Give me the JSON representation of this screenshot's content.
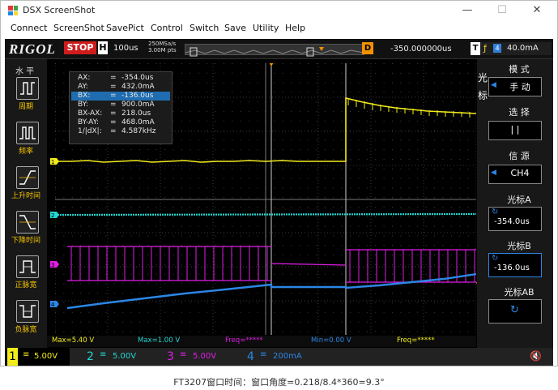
{
  "window": {
    "title": "DSX ScreenShot",
    "minimize": "—",
    "maximize": "☐",
    "close": "✕"
  },
  "menu": [
    "Connect",
    "ScreenShot",
    "SavePict",
    "Control",
    "Switch",
    "Save",
    "Utility",
    "Help"
  ],
  "scope": {
    "logo": "RIGOL",
    "run_state": "STOP",
    "timebase_label": "H",
    "timebase_value": "100us",
    "sample_rate": "250MSa/s",
    "mem_depth": "3.00M pts",
    "delay_label": "D",
    "delay_value": "-350.000000us",
    "trigger_label": "T",
    "trigger_source": "4",
    "trigger_level": "40.0mA",
    "colors": {
      "ch1": "#f3ec1c",
      "ch2": "#21d7d0",
      "ch3": "#e11ee6",
      "ch4": "#2c86e6",
      "accent": "#f29100"
    }
  },
  "left_panel": {
    "title": "水 平",
    "items": [
      {
        "icon": "period-icon",
        "label": "周期"
      },
      {
        "icon": "frequency-icon",
        "label": "频率"
      },
      {
        "icon": "rise-time-icon",
        "label": "上升时间"
      },
      {
        "icon": "fall-time-icon",
        "label": "下降时间"
      },
      {
        "icon": "positive-width-icon",
        "label": "正脉宽"
      },
      {
        "icon": "negative-width-icon",
        "label": "负脉宽"
      }
    ]
  },
  "cursor_readout": [
    {
      "k": "AX:",
      "v": "-354.0us"
    },
    {
      "k": "AY:",
      "v": "432.0mA"
    },
    {
      "k": "BX:",
      "v": "-136.0us"
    },
    {
      "k": "BY:",
      "v": "900.0mA"
    },
    {
      "k": "BX-AX:",
      "v": "218.0us"
    },
    {
      "k": "BY-AY:",
      "v": "468.0mA"
    },
    {
      "k": "1/|dX|:",
      "v": "4.587kHz"
    }
  ],
  "right_panel": {
    "cursor_tag": "光标",
    "mode_title": "模 式",
    "mode_value": "手 动",
    "select_title": "选 择",
    "select_value": "| |",
    "source_title": "信 源",
    "source_value": "CH4",
    "cursor_a_title": "光标A",
    "cursor_a_value": "-354.0us",
    "cursor_b_title": "光标B",
    "cursor_b_value": "-136.0us",
    "cursor_ab_title": "光标AB"
  },
  "measurements": [
    "Max=5.40 V",
    "Max=1.00 V",
    "Freq=*****",
    "Min=0.00 V",
    "Freq=*****"
  ],
  "channels": [
    {
      "num": "1",
      "scale": "5.00V"
    },
    {
      "num": "2",
      "scale": "5.00V"
    },
    {
      "num": "3",
      "scale": "5.00V"
    },
    {
      "num": "4",
      "scale": "200mA"
    }
  ],
  "caption": "FT3207窗口时间：窗口角度=0.218/8.4*360=9.3°"
}
